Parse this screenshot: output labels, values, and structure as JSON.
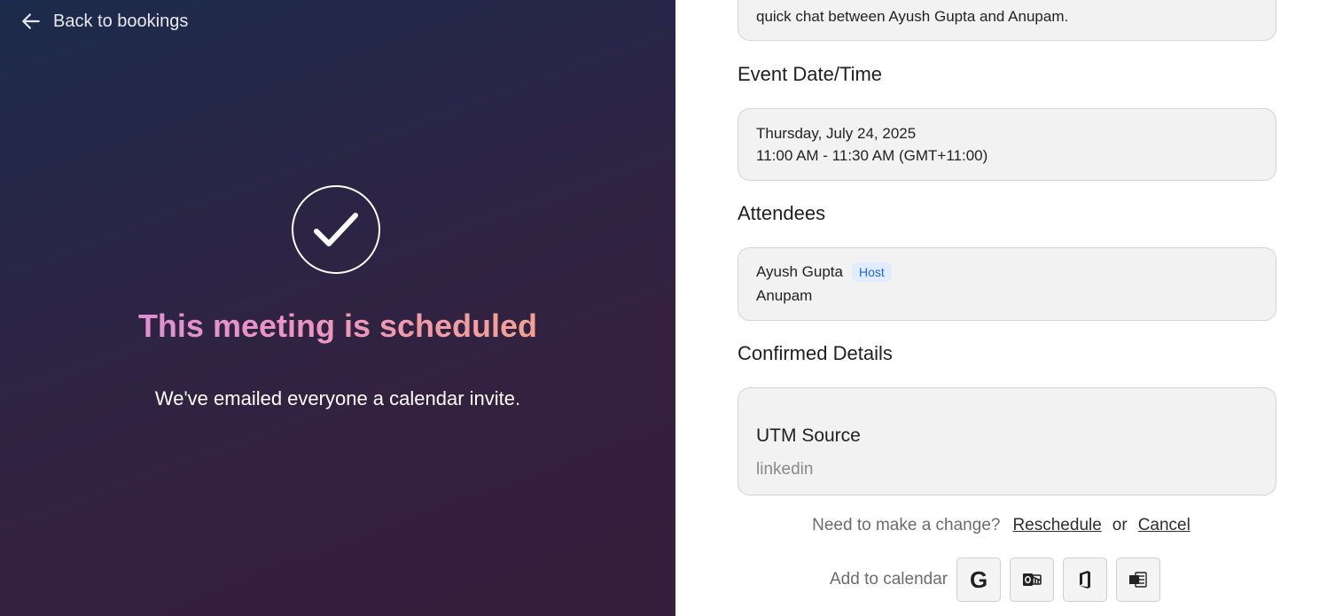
{
  "left": {
    "back_label": "Back to bookings",
    "headline": "This meeting is scheduled",
    "subline": "We've emailed everyone a calendar invite.",
    "gradient_colors": [
      "#1c2b4b",
      "#342140"
    ],
    "headline_gradient": [
      "#d58cd8",
      "#f5a58a"
    ]
  },
  "description": {
    "text": "quick chat between Ayush Gupta and Anupam."
  },
  "event": {
    "title": "Event Date/Time",
    "date": "Thursday, July 24, 2025",
    "time": "11:00 AM - 11:30 AM (GMT+11:00)"
  },
  "attendees": {
    "title": "Attendees",
    "items": [
      {
        "name": "Ayush Gupta",
        "badge": "Host"
      },
      {
        "name": "Anupam"
      }
    ]
  },
  "confirmed": {
    "title": "Confirmed Details",
    "key": "UTM Source",
    "value": "linkedin"
  },
  "actions": {
    "prompt": "Need to make a change?",
    "reschedule": "Reschedule",
    "or": "or",
    "cancel": "Cancel"
  },
  "calendar": {
    "label": "Add to calendar",
    "buttons": [
      {
        "icon": "google-icon",
        "glyph": "G"
      },
      {
        "icon": "outlook-icon"
      },
      {
        "icon": "office365-icon"
      },
      {
        "icon": "ics-file-icon"
      }
    ]
  }
}
